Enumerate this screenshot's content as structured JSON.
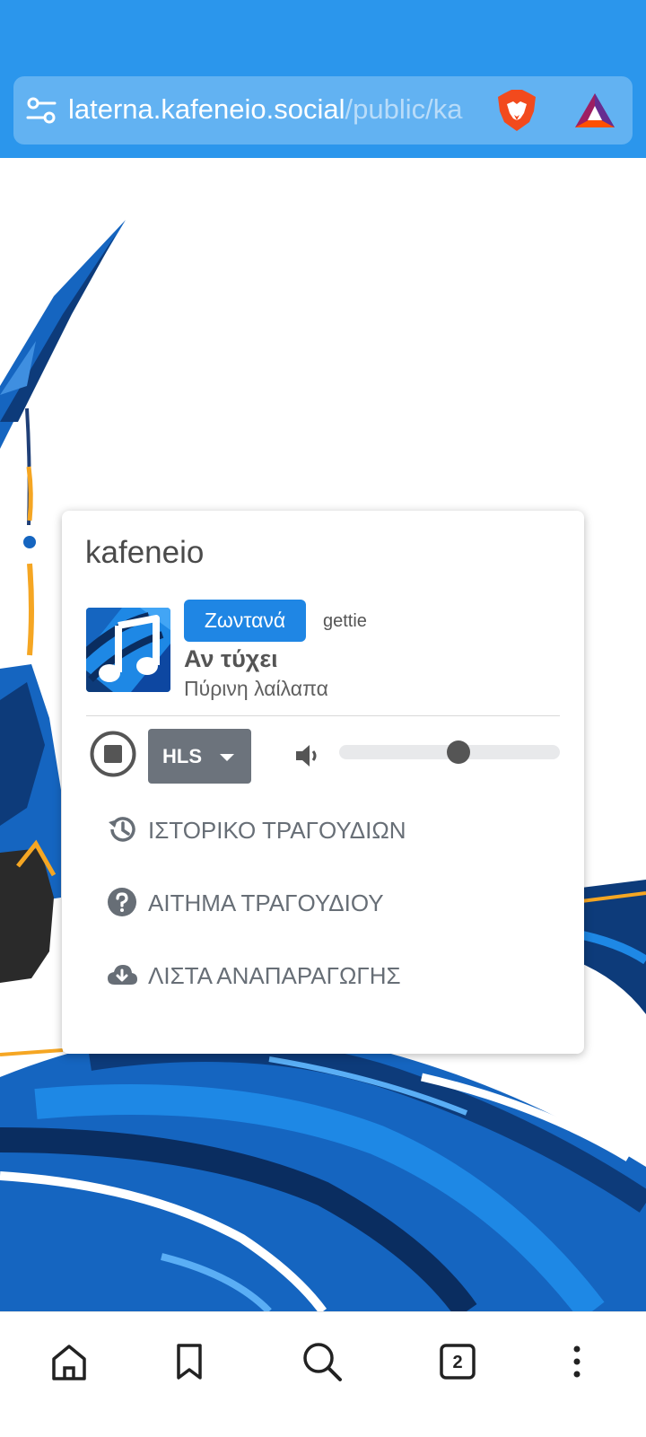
{
  "browser": {
    "url_host": "laterna.kafeneio.social",
    "url_path": "/public/ka",
    "icons": {
      "site_settings": "tune-icon",
      "shields": "brave-lion-icon",
      "rewards": "bat-triangle-icon"
    }
  },
  "player": {
    "station_name": "kafeneio",
    "live_label": "Ζωντανά",
    "dj_name": "gettie",
    "song_title": "Αν τύχει",
    "song_artist": "Πύρινη λαίλαπα",
    "format_label": "HLS",
    "volume": 0.54,
    "menu": [
      {
        "label": "ΙΣΤΟΡΙΚΟ ΤΡΑΓΟΥΔΙΩΝ",
        "icon": "history-icon"
      },
      {
        "label": "ΑΙΤΗΜΑ ΤΡΑΓΟΥΔΙΟΥ",
        "icon": "help-circle-icon"
      },
      {
        "label": "ΛΙΣΤΑ ΑΝΑΠΑΡΑΓΩΓΗΣ",
        "icon": "cloud-download-icon"
      }
    ]
  },
  "bottom_nav": {
    "tab_count": "2",
    "items": [
      "home-icon",
      "bookmark-icon",
      "search-icon",
      "tabs-icon",
      "more-vert-icon"
    ]
  },
  "colors": {
    "browser_blue": "#2b96ec",
    "live_badge": "#1f86e4",
    "art_blue": "#1565c0",
    "art_accent": "#f5a623"
  }
}
